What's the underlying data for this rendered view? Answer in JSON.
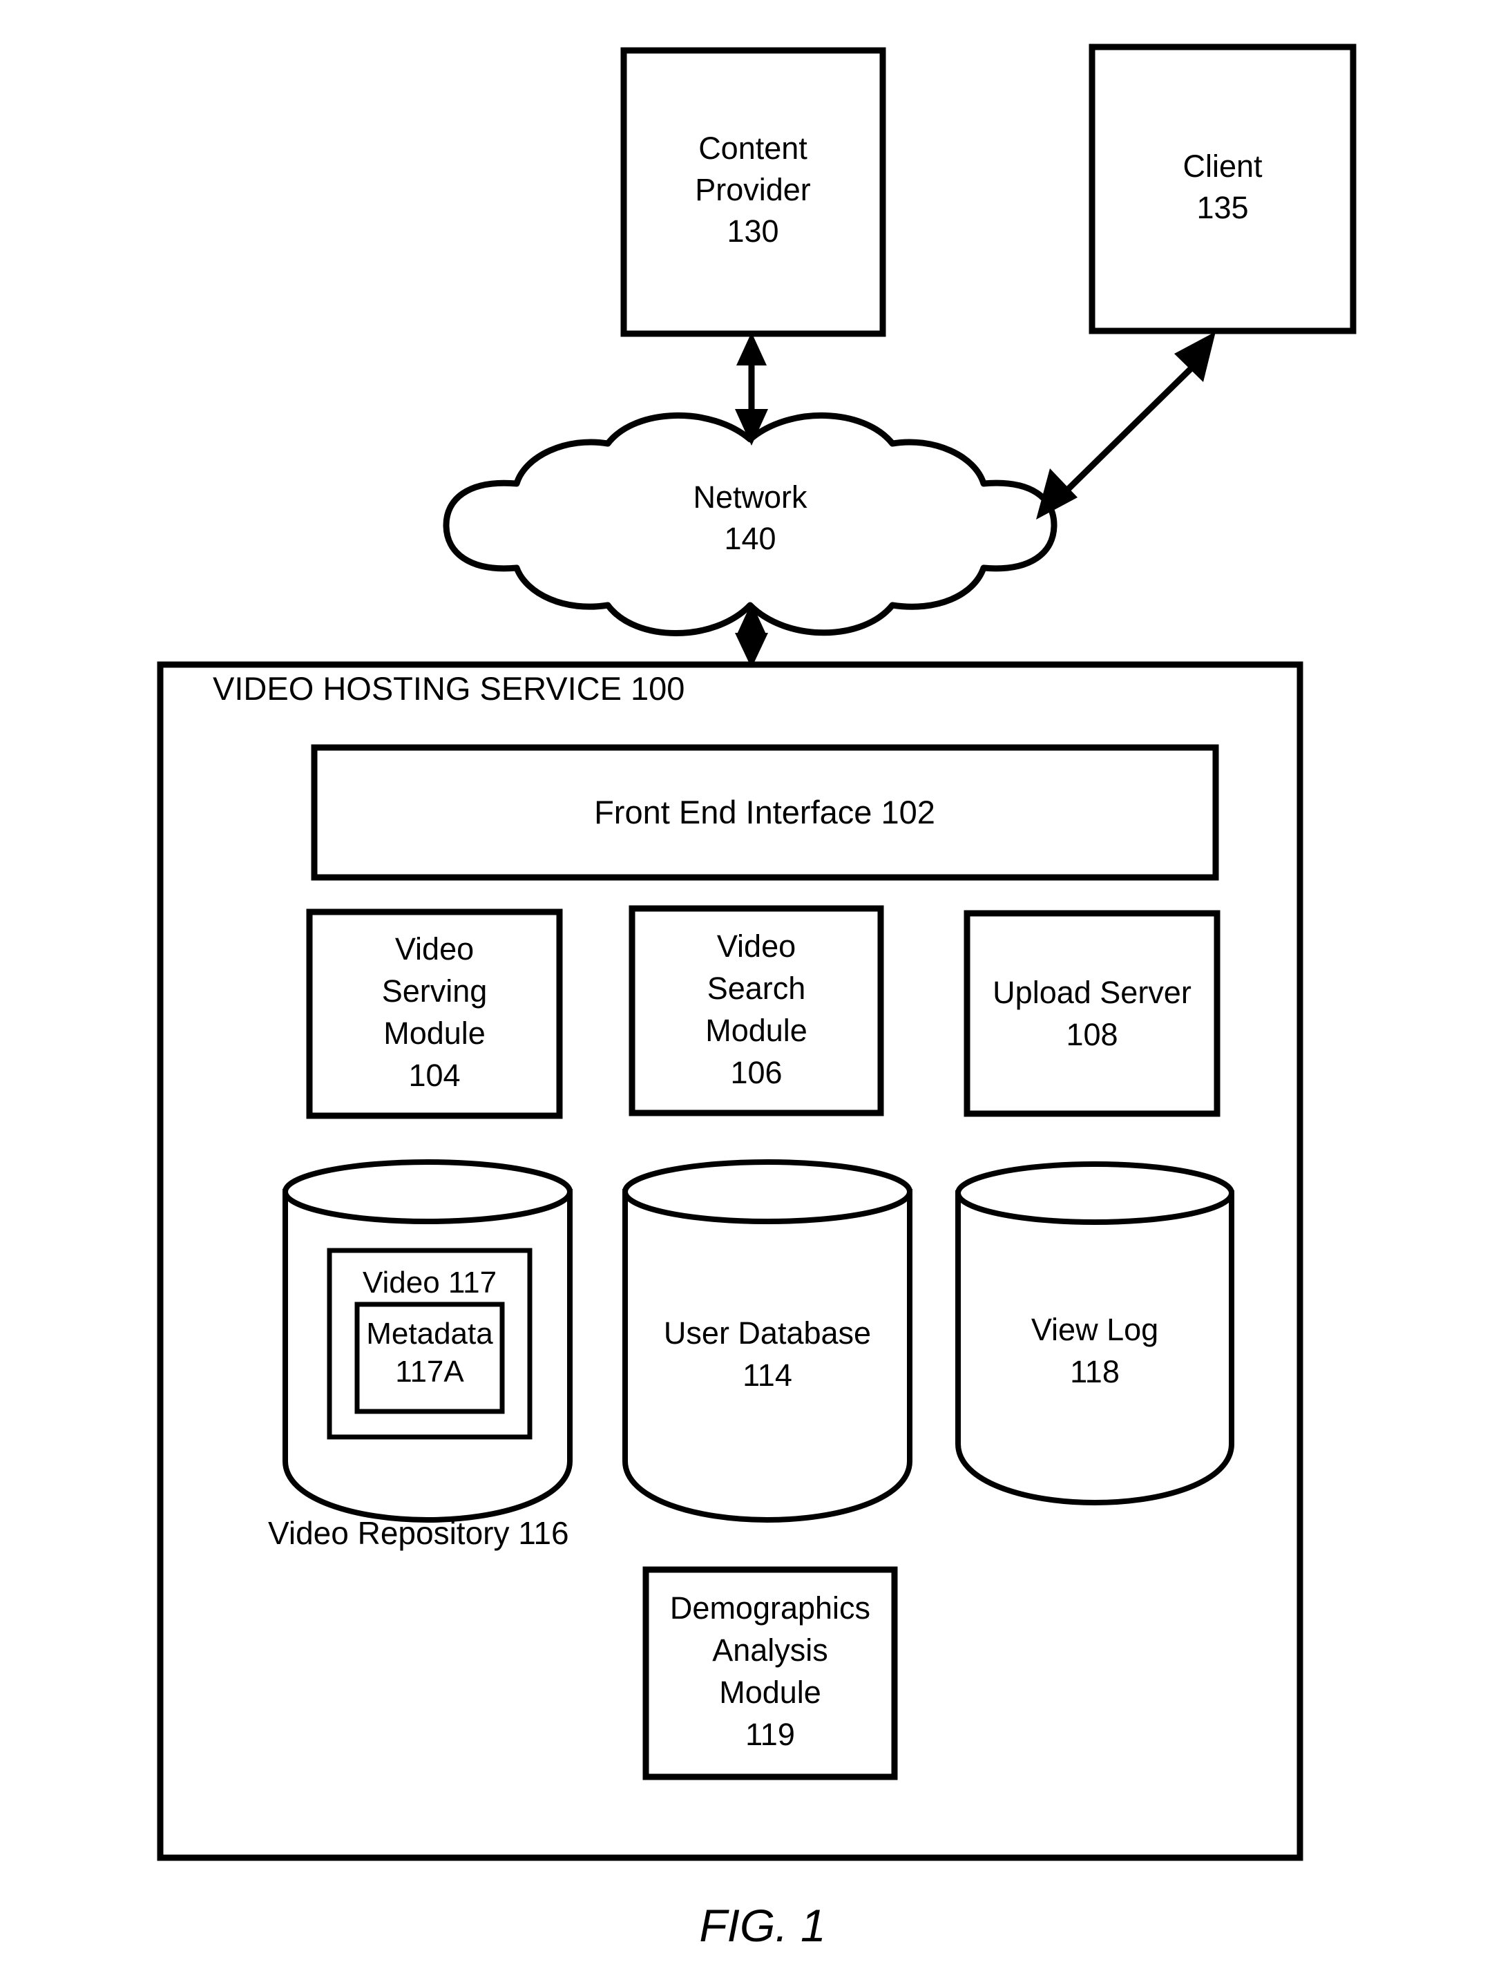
{
  "figure": {
    "caption": "FIG. 1",
    "stroke_color": "#000000",
    "background_color": "#ffffff"
  },
  "nodes": {
    "content_provider": {
      "line1": "Content",
      "line2": "Provider",
      "line3": "130"
    },
    "client": {
      "line1": "Client",
      "line2": "135"
    },
    "network": {
      "line1": "Network",
      "line2": "140"
    },
    "video_hosting_service": {
      "title": "VIDEO HOSTING SERVICE 100"
    },
    "front_end_interface": {
      "label": "Front End Interface 102"
    },
    "video_serving_module": {
      "line1": "Video",
      "line2": "Serving",
      "line3": "Module",
      "line4": "104"
    },
    "video_search_module": {
      "line1": "Video",
      "line2": "Search",
      "line3": "Module",
      "line4": "106"
    },
    "upload_server": {
      "line1": "Upload Server",
      "line2": "108"
    },
    "video_repository": {
      "outer_label": "Video Repository 116",
      "video_label": "Video 117",
      "metadata_line1": "Metadata",
      "metadata_line2": "117A"
    },
    "user_database": {
      "line1": "User Database",
      "line2": "114"
    },
    "view_log": {
      "line1": "View Log",
      "line2": "118"
    },
    "demographics_analysis_module": {
      "line1": "Demographics",
      "line2": "Analysis",
      "line3": "Module",
      "line4": "119"
    }
  },
  "connectors": [
    {
      "name": "content-provider-to-network",
      "style": "double-headed-vertical"
    },
    {
      "name": "client-to-network",
      "style": "double-headed-diagonal"
    },
    {
      "name": "network-to-video-hosting-service",
      "style": "double-headed-vertical"
    }
  ]
}
